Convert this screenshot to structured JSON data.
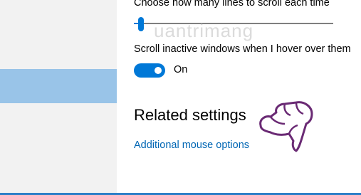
{
  "scroll": {
    "lines_label": "Choose how many lines to scroll each time",
    "lines_value_fraction": 0.02
  },
  "inactive_scroll": {
    "label": "Scroll inactive windows when I hover over them",
    "toggle_state": "On",
    "enabled": true
  },
  "related": {
    "heading": "Related settings",
    "link_label": "Additional mouse options"
  },
  "watermark": "uantrimang",
  "colors": {
    "accent": "#0078d7",
    "link": "#0066b4",
    "sidebar_bg": "#f2f2f2",
    "sidebar_selected": "#99c4e8"
  },
  "icons": {
    "cursor": "hand-pointer-icon"
  }
}
